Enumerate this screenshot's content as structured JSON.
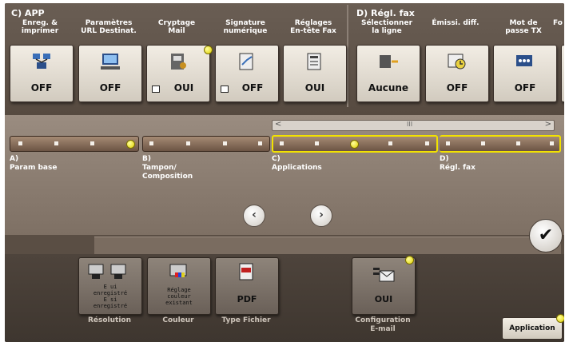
{
  "groups": {
    "app_title": "C)  APP",
    "fax_title": "D)  Régl. fax"
  },
  "function_buttons": [
    {
      "label": "Enreg. &\nimprimer",
      "value": "OFF",
      "icon": "network-print-icon"
    },
    {
      "label": "Paramètres\nURL Destinat.",
      "value": "OFF",
      "icon": "monitor-url-icon"
    },
    {
      "label": "Cryptage\nMail",
      "value": "OUI",
      "icon": "mail-encryption-icon"
    },
    {
      "label": "Signature\nnumérique",
      "value": "OFF",
      "icon": "digital-signature-icon"
    },
    {
      "label": "Réglages\nEn-tête Fax",
      "value": "OUI",
      "icon": "fax-header-icon"
    },
    {
      "label": "Sélectionner\nla ligne",
      "value": "Aucune",
      "icon": "line-select-icon"
    },
    {
      "label": "Émissi. diff.",
      "value": "OFF",
      "icon": "timer-send-icon"
    },
    {
      "label": "Mot de\npasse TX",
      "value": "OFF",
      "icon": "password-tx-icon"
    },
    {
      "label": "Fo",
      "value": "",
      "icon": ""
    }
  ],
  "categories": [
    {
      "label": "A)\nParam base"
    },
    {
      "label": "B)\nTampon/\nComposition"
    },
    {
      "label": "C)\nApplications"
    },
    {
      "label": "D)\nRégl. fax"
    }
  ],
  "scrollbar": {
    "left": "<",
    "right": ">",
    "mid": "III"
  },
  "nav": {
    "prev": "‹",
    "next": "›"
  },
  "confirm": "✔",
  "tray": [
    {
      "label": "Résolution",
      "text": "E ui\nenregistré\nE si\nenregistré"
    },
    {
      "label": "Couleur",
      "text": "Réglage\ncouleur\nexistant"
    },
    {
      "label": "Type Fichier",
      "text": "PDF"
    },
    {
      "label": "Configuration\nE-mail",
      "text": "OUI"
    }
  ],
  "app_button": "Application",
  "colors": {
    "accent": "#f2e200",
    "panel": "#5a4e44"
  }
}
